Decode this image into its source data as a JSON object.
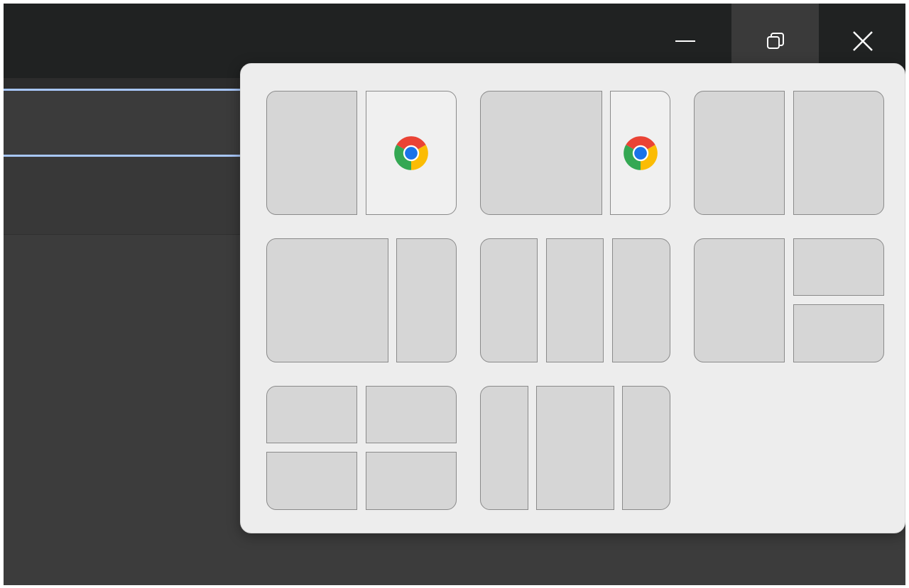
{
  "window": {
    "caption_buttons": [
      {
        "name": "minimize",
        "icon": "minimize-icon"
      },
      {
        "name": "restore",
        "icon": "restore-icon"
      },
      {
        "name": "close",
        "icon": "close-icon"
      }
    ]
  },
  "colors": {
    "titlebar": "#202222",
    "background": "#3c3c3c",
    "accent_line": "#a8c7fa",
    "flyout": "#ededed",
    "zone": "#d6d6d6",
    "zone_active": "#f0f0f0",
    "zone_border": "#8a8a8a"
  },
  "snap_layouts": [
    {
      "name": "two-equal-columns",
      "zones": 2,
      "active_zone_icon": "chrome-icon"
    },
    {
      "name": "wide-left-narrow-right",
      "zones": 2,
      "active_zone_icon": "chrome-icon"
    },
    {
      "name": "two-equal-columns-alt",
      "zones": 2
    },
    {
      "name": "two-thirds-one-third",
      "zones": 2
    },
    {
      "name": "three-equal-columns",
      "zones": 3
    },
    {
      "name": "left-column-right-stacked",
      "zones": 3
    },
    {
      "name": "four-quadrants",
      "zones": 4
    },
    {
      "name": "narrow-wide-narrow",
      "zones": 3
    }
  ]
}
